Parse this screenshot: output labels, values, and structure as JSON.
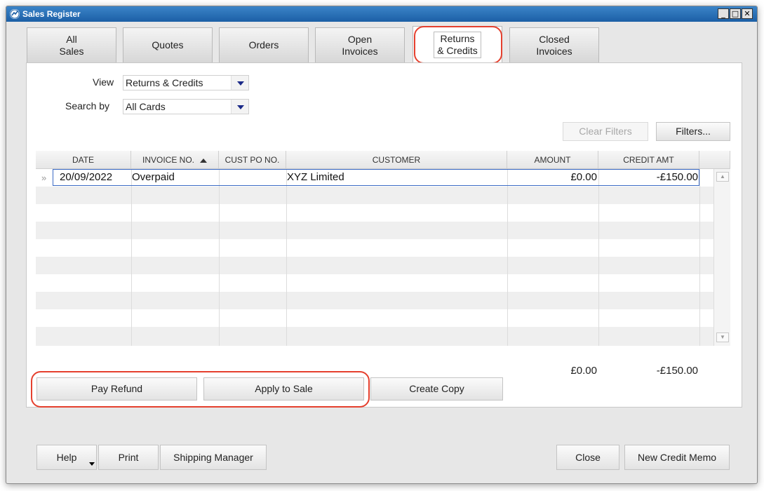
{
  "window": {
    "title": "Sales Register"
  },
  "tabs": [
    {
      "label": "All\nSales"
    },
    {
      "label": "Quotes"
    },
    {
      "label": "Orders"
    },
    {
      "label": "Open\nInvoices"
    },
    {
      "label": "Returns\n& Credits"
    },
    {
      "label": "Closed\nInvoices"
    }
  ],
  "filters": {
    "view_label": "View",
    "view_value": "Returns & Credits",
    "search_label": "Search by",
    "search_value": "All Cards",
    "clear_filters": "Clear Filters",
    "filters_button": "Filters..."
  },
  "table": {
    "columns": [
      "DATE",
      "INVOICE NO.",
      "CUST PO NO.",
      "CUSTOMER",
      "AMOUNT",
      "CREDIT AMT"
    ],
    "rows": [
      {
        "date": "20/09/2022",
        "invoice": "Overpaid",
        "cust_po": "",
        "customer": "XYZ Limited",
        "amount": "£0.00",
        "credit": "-£150.00"
      }
    ],
    "total_amount": "£0.00",
    "total_credit": "-£150.00"
  },
  "actions": {
    "pay_refund": "Pay Refund",
    "apply_to_sale": "Apply to Sale",
    "create_copy": "Create Copy"
  },
  "footer": {
    "help": "Help",
    "print": "Print",
    "shipping": "Shipping Manager",
    "close": "Close",
    "new_credit_memo": "New Credit Memo"
  },
  "colors": {
    "highlight": "#e5402e",
    "titlebar": "#1c5fa6",
    "selection": "#3c6bc5"
  }
}
